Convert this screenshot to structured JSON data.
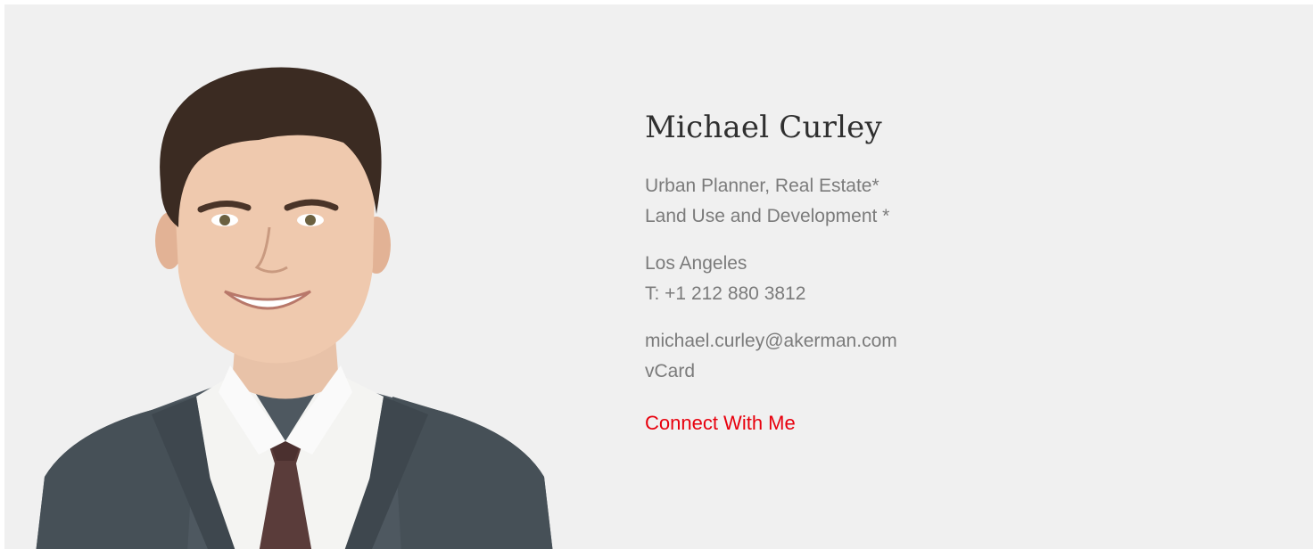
{
  "profile": {
    "name": "Michael Curley",
    "titles": [
      "Urban Planner, Real Estate*",
      "Land Use and Development *"
    ],
    "location": "Los Angeles",
    "phone": "T: +1 212 880 3812",
    "email": "michael.curley@akerman.com",
    "vcard_label": "vCard",
    "connect_label": "Connect With Me"
  },
  "colors": {
    "panel_background": "#f0f0f0",
    "name_text": "#2f2f2f",
    "detail_text": "#7b7b7b",
    "accent": "#e8000d"
  },
  "icons": {
    "portrait": "headshot-photo"
  }
}
